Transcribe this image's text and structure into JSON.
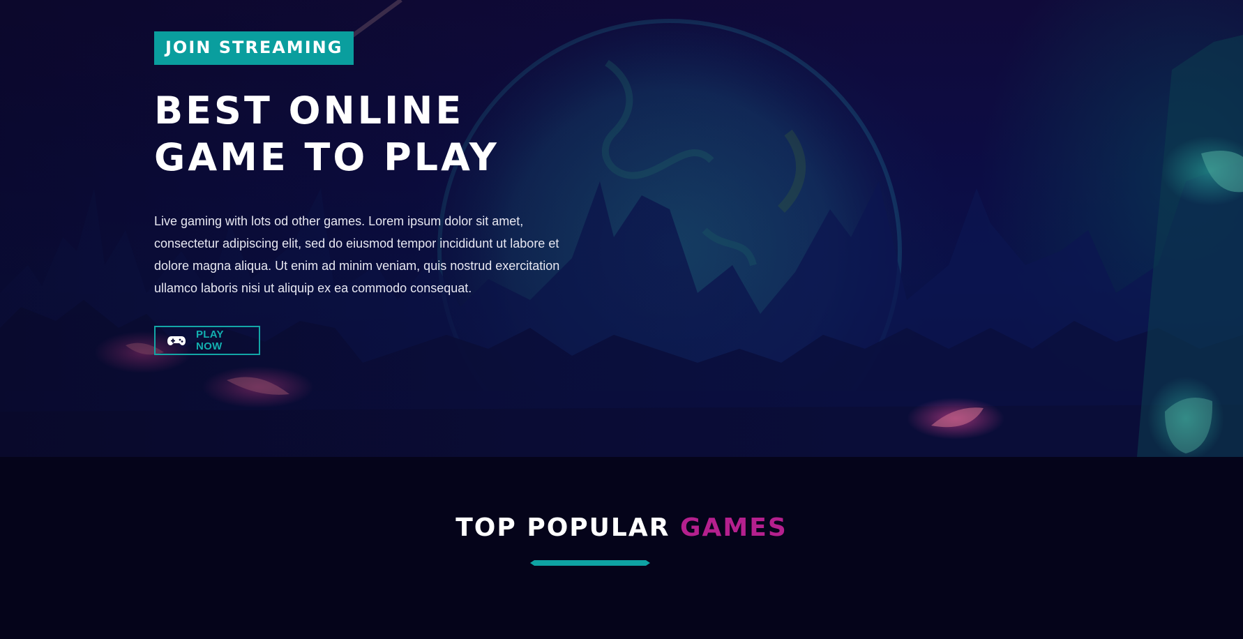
{
  "hero": {
    "badge": "JOIN STREAMING",
    "title_line1": "BEST ONLINE",
    "title_line2": "GAME TO PLAY",
    "description": "Live gaming with lots od other games. Lorem ipsum dolor sit amet, consectetur adipiscing elit, sed do eiusmod tempor incididunt ut labore et dolore magna aliqua. Ut enim ad minim veniam, quis nostrud exercitation ullamco laboris nisi ut aliquip ex ea commodo consequat.",
    "play_button_label": "PLAY NOW",
    "play_button_icon": "gamepad-icon"
  },
  "popular": {
    "title_part1": "TOP POPULAR",
    "title_part2": "GAMES"
  },
  "colors": {
    "accent_teal": "#0a9e9e",
    "accent_magenta": "#b5208e",
    "background": "#05041a"
  }
}
